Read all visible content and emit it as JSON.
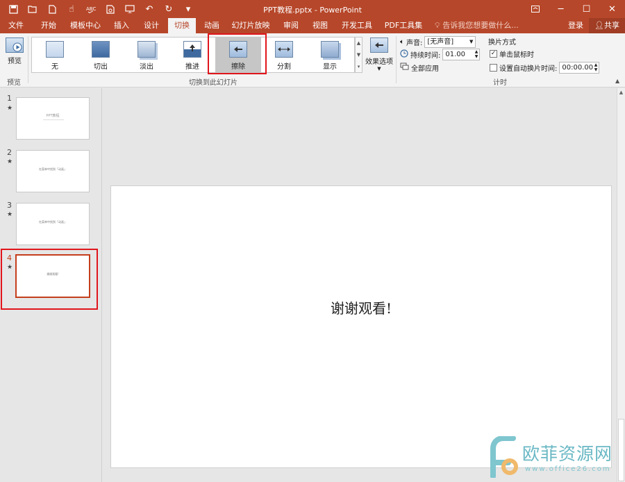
{
  "window": {
    "title": "PPT教程.pptx - PowerPoint",
    "ribbon_display_icon": "ribbon-display-icon",
    "min_label": "─",
    "max_label": "☐",
    "close_label": "✕"
  },
  "qat": {
    "save_icon": "save-icon",
    "open_icon": "open-icon",
    "new_icon": "new-file-icon",
    "touch_icon": "touch-mode-icon",
    "spell_icon": "spell-check-icon",
    "preview_icon": "print-preview-icon",
    "presenter_icon": "slideshow-icon",
    "undo_icon": "undo-icon",
    "redo_icon": "redo-icon",
    "customize_icon": "customize-qat-icon"
  },
  "tabs": [
    "文件",
    "开始",
    "模板中心",
    "插入",
    "设计",
    "切换",
    "动画",
    "幻灯片放映",
    "审阅",
    "视图",
    "开发工具",
    "PDF工具集"
  ],
  "active_tab": "切换",
  "tell_me": "告诉我您想要做什么...",
  "login": "登录",
  "share": "共享",
  "ribbon": {
    "preview": {
      "button_label": "预览",
      "group_label": "预览"
    },
    "transitions": {
      "group_label": "切换到此幻灯片",
      "items": [
        "无",
        "切出",
        "淡出",
        "推进",
        "擦除",
        "分割",
        "显示"
      ],
      "selected": "擦除",
      "effect_options": "效果选项"
    },
    "timing": {
      "group_label": "计时",
      "sound_label": "声音:",
      "sound_value": "[无声音]",
      "duration_label": "持续时间:",
      "duration_value": "01.00",
      "apply_all": "全部应用",
      "advance_title": "换片方式",
      "on_click": "单击鼠标时",
      "on_click_checked": true,
      "after_label": "设置自动换片时间:",
      "after_checked": false,
      "after_value": "00:00.00"
    }
  },
  "slides": [
    {
      "number": "1",
      "star": "★",
      "text": "PPT教程"
    },
    {
      "number": "2",
      "star": "★",
      "text": "在菜单中找到「动画」"
    },
    {
      "number": "3",
      "star": "★",
      "text": "在菜单中找到「动画」"
    },
    {
      "number": "4",
      "star": "★",
      "text": "谢谢观看!"
    }
  ],
  "selected_slide": "4",
  "main_slide": {
    "text": "谢谢观看!"
  },
  "watermark": {
    "name": "欧菲资源网",
    "url": "www.office26.com"
  },
  "colors": {
    "accent": "#b7472a",
    "highlight": "#e0151c"
  }
}
